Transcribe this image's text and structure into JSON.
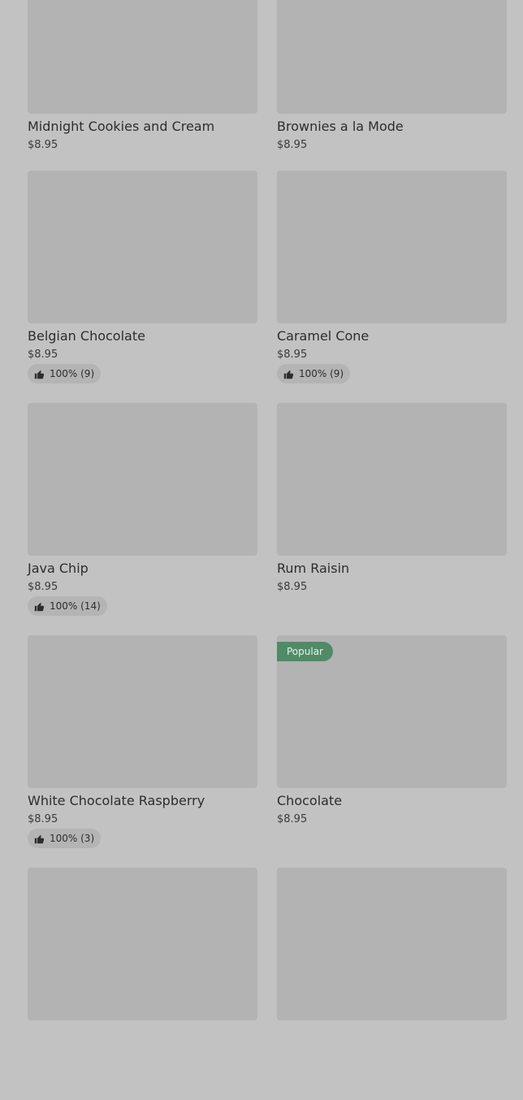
{
  "products": [
    {
      "name": "Midnight Cookies and Cream",
      "price": "$8.95",
      "rating": null,
      "badge": null
    },
    {
      "name": "Brownies a la Mode",
      "price": "$8.95",
      "rating": null,
      "badge": null
    },
    {
      "name": "Belgian Chocolate",
      "price": "$8.95",
      "rating": "100% (9)",
      "badge": null
    },
    {
      "name": "Caramel Cone",
      "price": "$8.95",
      "rating": "100% (9)",
      "badge": null
    },
    {
      "name": "Java Chip",
      "price": "$8.95",
      "rating": "100% (14)",
      "badge": null
    },
    {
      "name": "Rum Raisin",
      "price": "$8.95",
      "rating": null,
      "badge": null
    },
    {
      "name": "White Chocolate Raspberry",
      "price": "$8.95",
      "rating": "100% (3)",
      "badge": null
    },
    {
      "name": "Chocolate",
      "price": "$8.95",
      "rating": null,
      "badge": "Popular"
    },
    {
      "name": "",
      "price": "",
      "rating": null,
      "badge": null
    },
    {
      "name": "",
      "price": "",
      "rating": null,
      "badge": null
    }
  ],
  "colors": {
    "background": "#c2c2c2",
    "image_placeholder": "#b3b3b3",
    "rating_pill": "#b4b4b4",
    "popular_badge": "#4f8b67"
  },
  "icons": {
    "rating": "thumbs-up-icon"
  }
}
